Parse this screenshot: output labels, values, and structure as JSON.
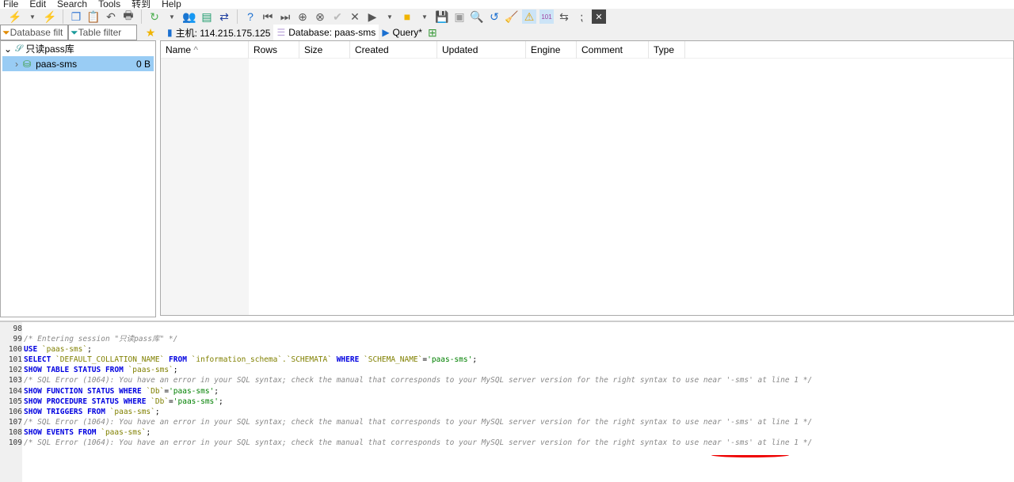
{
  "menu": [
    "File",
    "Edit",
    "Search",
    "Tools",
    "转到",
    "Help"
  ],
  "filters": {
    "database": "Database filt",
    "table": "Table filter"
  },
  "tabs": [
    {
      "label": "主机: 114.215.175.125"
    },
    {
      "label": "Database: paas-sms"
    },
    {
      "label": "Query*"
    }
  ],
  "tree": {
    "session": "只读pass库",
    "db": {
      "name": "paas-sms",
      "size": "0 B"
    }
  },
  "columns": [
    "Name",
    "Rows",
    "Size",
    "Created",
    "Updated",
    "Engine",
    "Comment",
    "Type"
  ],
  "log": [
    {
      "n": "98",
      "parts": []
    },
    {
      "n": "99",
      "parts": [
        {
          "t": "cm",
          "v": "/* Entering session \"只读pass库\" */"
        }
      ]
    },
    {
      "n": "100",
      "parts": [
        {
          "t": "kw",
          "v": "USE "
        },
        {
          "t": "id",
          "v": "`paas-sms`"
        },
        {
          "t": "",
          "v": ";"
        }
      ]
    },
    {
      "n": "101",
      "parts": [
        {
          "t": "kw",
          "v": "SELECT "
        },
        {
          "t": "id",
          "v": "`DEFAULT_COLLATION_NAME`"
        },
        {
          "t": "kw",
          "v": " FROM "
        },
        {
          "t": "id",
          "v": "`information_schema`.`SCHEMATA`"
        },
        {
          "t": "kw",
          "v": " WHERE "
        },
        {
          "t": "id",
          "v": "`SCHEMA_NAME`"
        },
        {
          "t": "",
          "v": "="
        },
        {
          "t": "str",
          "v": "'paas-sms'"
        },
        {
          "t": "",
          "v": ";"
        }
      ]
    },
    {
      "n": "102",
      "parts": [
        {
          "t": "kw",
          "v": "SHOW TABLE STATUS FROM "
        },
        {
          "t": "id",
          "v": "`paas-sms`"
        },
        {
          "t": "",
          "v": ";"
        }
      ]
    },
    {
      "n": "103",
      "parts": [
        {
          "t": "cm",
          "v": "/* SQL Error (1064): You have an error in your SQL syntax; check the manual that corresponds to your MySQL server version for the right syntax to use near '-sms' at line 1 */"
        }
      ]
    },
    {
      "n": "104",
      "parts": [
        {
          "t": "kw",
          "v": "SHOW FUNCTION STATUS WHERE "
        },
        {
          "t": "id",
          "v": "`Db`"
        },
        {
          "t": "",
          "v": "="
        },
        {
          "t": "str",
          "v": "'paas-sms'"
        },
        {
          "t": "",
          "v": ";"
        }
      ]
    },
    {
      "n": "105",
      "parts": [
        {
          "t": "kw",
          "v": "SHOW PROCEDURE STATUS WHERE "
        },
        {
          "t": "id",
          "v": "`Db`"
        },
        {
          "t": "",
          "v": "="
        },
        {
          "t": "str",
          "v": "'paas-sms'"
        },
        {
          "t": "",
          "v": ";"
        }
      ]
    },
    {
      "n": "106",
      "parts": [
        {
          "t": "kw",
          "v": "SHOW TRIGGERS FROM "
        },
        {
          "t": "id",
          "v": "`paas-sms`"
        },
        {
          "t": "",
          "v": ";"
        }
      ]
    },
    {
      "n": "107",
      "parts": [
        {
          "t": "cm",
          "v": "/* SQL Error (1064): You have an error in your SQL syntax; check the manual that corresponds to your MySQL server version for the right syntax to use near '-sms' at line 1 */"
        }
      ]
    },
    {
      "n": "108",
      "parts": [
        {
          "t": "kw",
          "v": "SHOW EVENTS FROM "
        },
        {
          "t": "id",
          "v": "`paas-sms`"
        },
        {
          "t": "",
          "v": ";"
        }
      ]
    },
    {
      "n": "109",
      "parts": [
        {
          "t": "cm",
          "v": "/* SQL Error (1064): You have an error in your SQL syntax; check the manual that corresponds to your MySQL server version for the right syntax to use near '-sms' at line 1 */"
        }
      ]
    }
  ],
  "icons": [
    "connect",
    "disconnect",
    "copy",
    "paste",
    "undo",
    "print",
    "refresh",
    "user-manager",
    "export",
    "sync",
    "help",
    "first",
    "last",
    "add",
    "remove",
    "apply",
    "cancel",
    "run",
    "open-folder",
    "save",
    "save-as",
    "find",
    "replace",
    "clear",
    "warning",
    "binary",
    "wrap",
    "more",
    "close"
  ]
}
